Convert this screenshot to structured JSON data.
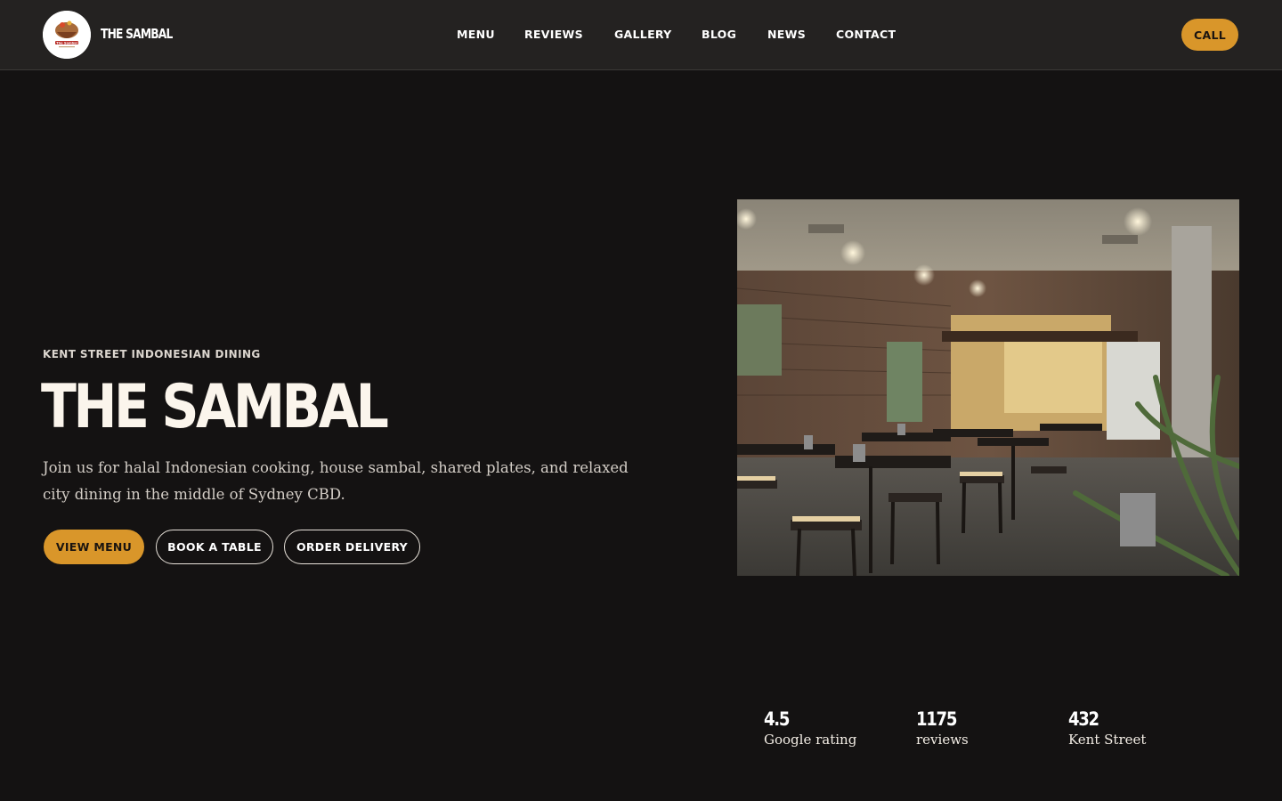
{
  "header": {
    "brand": "THE SAMBAL",
    "logo_text": "The Sambal",
    "nav": [
      "MENU",
      "REVIEWS",
      "GALLERY",
      "BLOG",
      "NEWS",
      "CONTACT"
    ],
    "call_label": "CALL"
  },
  "hero": {
    "eyebrow": "KENT STREET INDONESIAN DINING",
    "title": "THE SAMBAL",
    "description": "Join us for halal Indonesian cooking, house sambal, shared plates, and relaxed city dining in the middle of Sydney CBD.",
    "buttons": {
      "view_menu": "VIEW MENU",
      "book_table": "BOOK A TABLE",
      "order_delivery": "ORDER DELIVERY"
    }
  },
  "stats": [
    {
      "value": "4.5",
      "label": "Google rating"
    },
    {
      "value": "1175",
      "label": "reviews"
    },
    {
      "value": "432",
      "label": "Kent Street"
    }
  ],
  "colors": {
    "accent": "#d9962a",
    "background": "#141212",
    "header_bg": "#242221"
  }
}
